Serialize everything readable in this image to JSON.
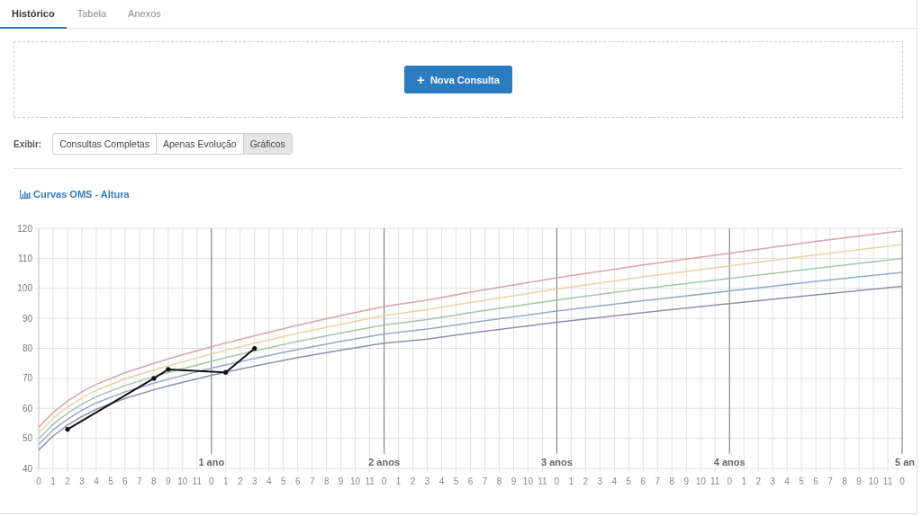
{
  "tabs": [
    {
      "label": "Histórico",
      "selected": true
    },
    {
      "label": "Tabela",
      "selected": false
    },
    {
      "label": "Anexos",
      "selected": false
    }
  ],
  "new_button": {
    "icon": "+",
    "label": "Nova Consulta"
  },
  "view": {
    "label": "Exibir:",
    "options": [
      {
        "label": "Consultas Completas",
        "selected": false
      },
      {
        "label": "Apenas Evolução",
        "selected": false
      },
      {
        "label": "Gráficos",
        "selected": true
      }
    ]
  },
  "chart_title": "Curvas OMS - Altura",
  "month_labels": [
    "0",
    "1",
    "2",
    "3",
    "4",
    "5",
    "6",
    "7",
    "8",
    "9",
    "10",
    "11",
    "0",
    "1",
    "2",
    "3",
    "4",
    "5",
    "6",
    "7",
    "8",
    "9",
    "10",
    "11",
    "0",
    "1",
    "2",
    "3",
    "4",
    "5",
    "6",
    "7",
    "8",
    "9",
    "10",
    "11",
    "0",
    "1",
    "2",
    "3",
    "4",
    "5",
    "6",
    "7",
    "8",
    "9",
    "10",
    "11",
    "0",
    "1",
    "2",
    "3",
    "4",
    "5",
    "6",
    "7",
    "8",
    "9",
    "10",
    "11",
    "0"
  ],
  "chart_data": {
    "type": "line",
    "grid": true,
    "xlim": [
      0,
      5
    ],
    "ylim": [
      40,
      120
    ],
    "yticks": [
      40,
      50,
      60,
      70,
      80,
      90,
      100,
      110,
      120
    ],
    "xticks": [
      {
        "value": 1,
        "label": "1 ano"
      },
      {
        "value": 2,
        "label": "2 anos"
      },
      {
        "value": 3,
        "label": "3 anos"
      },
      {
        "value": 4,
        "label": "4 anos"
      },
      {
        "value": 5,
        "label": "5 an"
      }
    ],
    "x": [
      0,
      0.083,
      0.167,
      0.25,
      0.333,
      0.5,
      0.667,
      0.75,
      1,
      1.083,
      1.25,
      1.5,
      1.75,
      2,
      2.25,
      2.5,
      3,
      3.5,
      4,
      4.5,
      5
    ],
    "series": [
      {
        "color": "#d9a3ab",
        "values": [
          53.7,
          58.6,
          62.4,
          65.5,
          68.0,
          71.9,
          75.0,
          76.5,
          80.5,
          81.8,
          84.2,
          87.7,
          90.9,
          93.9,
          96.1,
          98.7,
          103.5,
          107.8,
          111.7,
          115.7,
          119.2
        ]
      },
      {
        "color": "#ead39e",
        "values": [
          51.8,
          56.7,
          60.4,
          63.5,
          66.0,
          69.8,
          72.8,
          74.2,
          78.1,
          79.3,
          81.7,
          85.0,
          88.0,
          90.9,
          92.9,
          95.3,
          99.8,
          103.8,
          107.5,
          111.2,
          114.6
        ]
      },
      {
        "color": "#9fc7ad",
        "values": [
          49.9,
          54.7,
          58.4,
          61.4,
          63.9,
          67.6,
          70.6,
          72.0,
          75.7,
          76.9,
          79.1,
          82.3,
          85.1,
          87.8,
          89.6,
          91.9,
          96.1,
          99.9,
          103.3,
          106.7,
          110.0
        ]
      },
      {
        "color": "#8eaac9",
        "values": [
          48.0,
          52.8,
          56.4,
          59.4,
          61.8,
          65.5,
          68.4,
          69.7,
          73.4,
          74.5,
          76.6,
          79.6,
          82.3,
          84.8,
          86.4,
          88.5,
          92.4,
          95.9,
          99.1,
          102.3,
          105.3
        ]
      },
      {
        "color": "#8b91a9",
        "values": [
          46.1,
          50.8,
          54.4,
          57.3,
          59.7,
          63.3,
          66.2,
          67.5,
          71.0,
          72.1,
          74.1,
          76.9,
          79.4,
          81.7,
          83.1,
          85.1,
          88.7,
          91.9,
          94.9,
          97.8,
          100.7
        ]
      },
      {
        "color": "#111111",
        "x": [
          0.167,
          0.667,
          0.75,
          1.083,
          1.25
        ],
        "values": [
          53,
          70,
          73,
          72,
          80
        ]
      }
    ]
  }
}
